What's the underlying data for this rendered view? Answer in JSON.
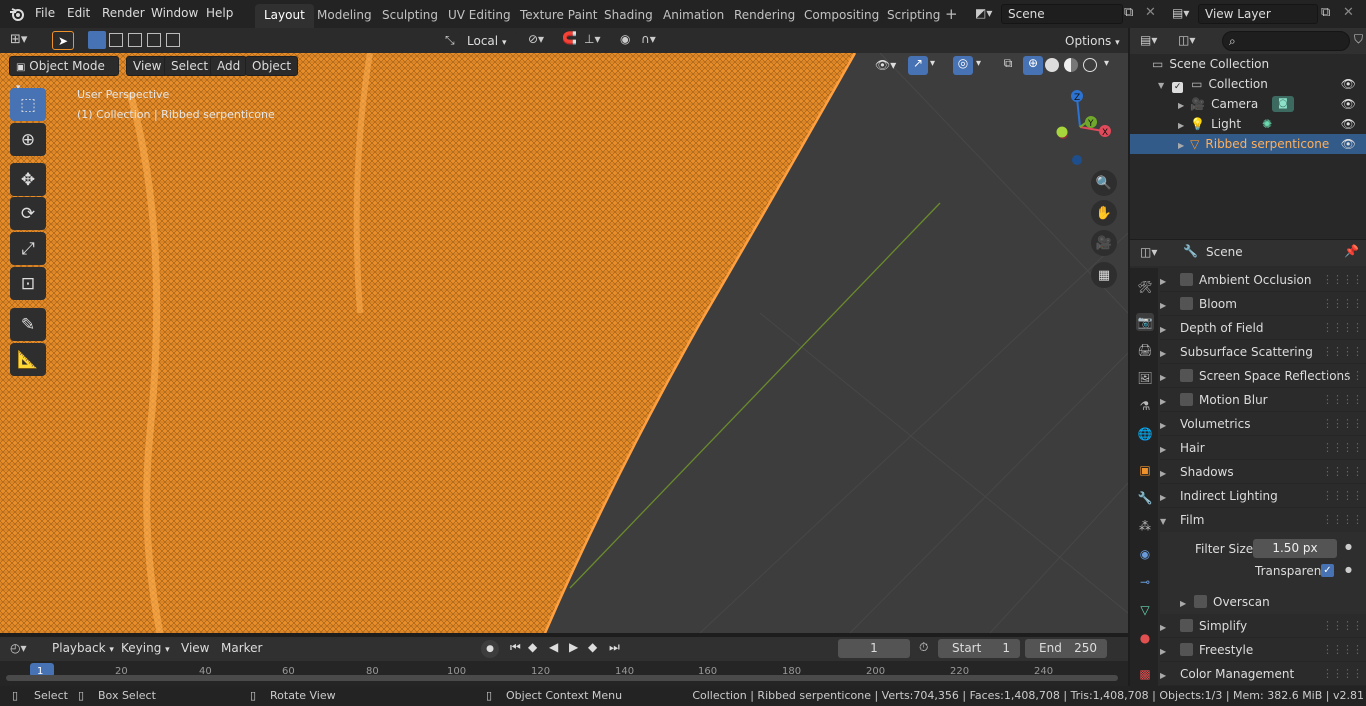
{
  "topbar": {
    "menus": [
      "File",
      "Edit",
      "Render",
      "Window",
      "Help"
    ],
    "workspaces": [
      "Layout",
      "Modeling",
      "Sculpting",
      "UV Editing",
      "Texture Paint",
      "Shading",
      "Animation",
      "Rendering",
      "Compositing",
      "Scripting"
    ],
    "active_workspace": "Layout",
    "scene_name": "Scene",
    "view_layer": "View Layer"
  },
  "viewport_header": {
    "transform_orientation": "Local",
    "options_label": "Options",
    "mode": "Object Mode",
    "menus": [
      "View",
      "Select",
      "Add",
      "Object"
    ]
  },
  "viewport": {
    "perspective_label": "User Perspective",
    "collection_label": "(1) Collection | Ribbed serpenticone",
    "mesh_color": "#f0922c",
    "gizmo": {
      "x": "X",
      "y": "Y",
      "z": "Z"
    }
  },
  "toolbar_icons": [
    "select-box",
    "cursor",
    "move",
    "rotate",
    "scale",
    "transform",
    "annotate",
    "measure"
  ],
  "outliner": {
    "root": "Scene Collection",
    "collection": "Collection",
    "items": [
      {
        "name": "Camera",
        "icon": "camera-icon",
        "selected": false
      },
      {
        "name": "Light",
        "icon": "light-icon",
        "selected": false
      },
      {
        "name": "Ribbed serpenticone",
        "icon": "mesh-icon",
        "selected": true
      }
    ]
  },
  "properties": {
    "context": "Scene",
    "panels": [
      {
        "label": "Ambient Occlusion",
        "checkbox": true,
        "checked": false
      },
      {
        "label": "Bloom",
        "checkbox": true,
        "checked": false
      },
      {
        "label": "Depth of Field",
        "checkbox": false
      },
      {
        "label": "Subsurface Scattering",
        "checkbox": false
      },
      {
        "label": "Screen Space Reflections",
        "checkbox": true,
        "checked": false
      },
      {
        "label": "Motion Blur",
        "checkbox": true,
        "checked": false
      },
      {
        "label": "Volumetrics",
        "checkbox": false
      },
      {
        "label": "Hair",
        "checkbox": false
      },
      {
        "label": "Shadows",
        "checkbox": false
      },
      {
        "label": "Indirect Lighting",
        "checkbox": false
      },
      {
        "label": "Film",
        "checkbox": false,
        "expanded": true
      }
    ],
    "film": {
      "filter_size_label": "Filter Size",
      "filter_size_value": "1.50 px",
      "transparent_label": "Transparent",
      "transparent": true,
      "overscan_label": "Overscan"
    },
    "panels_after": [
      {
        "label": "Simplify",
        "checkbox": true
      },
      {
        "label": "Freestyle",
        "checkbox": true
      },
      {
        "label": "Color Management",
        "checkbox": false
      }
    ]
  },
  "timeline": {
    "menus": [
      "Playback",
      "Keying",
      "View",
      "Marker"
    ],
    "current_frame": "1",
    "start_label": "Start",
    "start": "1",
    "end_label": "End",
    "end": "250",
    "ticks": [
      "1",
      "20",
      "40",
      "60",
      "80",
      "100",
      "120",
      "140",
      "160",
      "180",
      "200",
      "220",
      "240"
    ]
  },
  "statusbar": {
    "select": "Select",
    "box_select": "Box Select",
    "rotate_view": "Rotate View",
    "context_menu": "Object Context Menu",
    "stats": "Collection | Ribbed serpenticone | Verts:704,356 | Faces:1,408,708 | Tris:1,408,708 | Objects:1/3 | Mem: 382.6 MiB | v2.81"
  }
}
